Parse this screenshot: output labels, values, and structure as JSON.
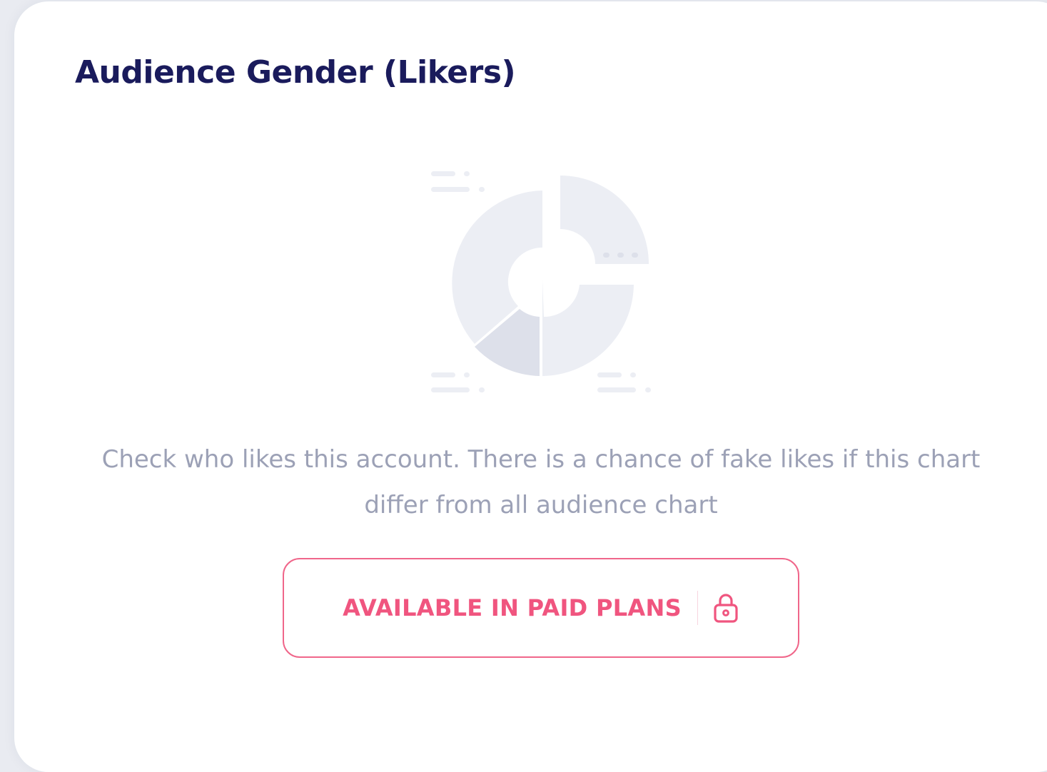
{
  "card": {
    "title": "Audience Gender (Likers)",
    "illustration_icon": "donut-chart-placeholder-icon",
    "description": "Check who likes this account. There is a chance of fake likes if this chart differ from all audience chart",
    "button": {
      "label": "AVAILABLE IN PAID PLANS",
      "icon": "lock-icon"
    }
  },
  "colors": {
    "title": "#1a1b5c",
    "description": "#9ca1b6",
    "accent": "#f0557f",
    "placeholder": "#eceef4",
    "placeholder_dark": "#dde0ea"
  }
}
